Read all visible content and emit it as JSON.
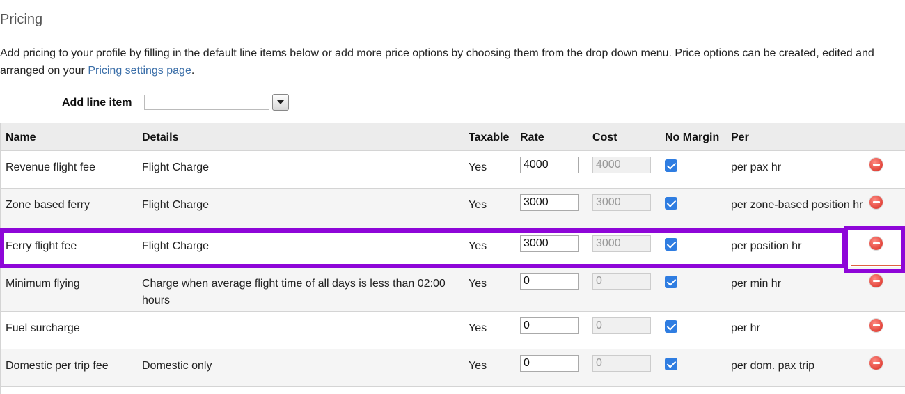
{
  "page": {
    "title": "Pricing",
    "intro_text": "Add pricing to your profile by filling in the default line items below or add more price options by choosing them from the drop down menu. Price options can be created, edited and arranged on your ",
    "intro_link": "Pricing settings page",
    "intro_end": "."
  },
  "add_line_item": {
    "label": "Add line item",
    "selected": ""
  },
  "table": {
    "headers": {
      "name": "Name",
      "details": "Details",
      "taxable": "Taxable",
      "rate": "Rate",
      "cost": "Cost",
      "no_margin": "No Margin",
      "per": "Per"
    },
    "rows": [
      {
        "name": "Revenue flight fee",
        "details": "Flight Charge",
        "taxable": "Yes",
        "rate": "4000",
        "cost": "4000",
        "no_margin": true,
        "per": "per pax hr"
      },
      {
        "name": "Zone based ferry",
        "details": "Flight Charge",
        "taxable": "Yes",
        "rate": "3000",
        "cost": "3000",
        "no_margin": true,
        "per": "per zone-based position hr"
      },
      {
        "name": "Ferry flight fee",
        "details": "Flight Charge",
        "taxable": "Yes",
        "rate": "3000",
        "cost": "3000",
        "no_margin": true,
        "per": "per position hr",
        "highlighted": true
      },
      {
        "name": "Minimum flying",
        "details": "Charge when average flight time of all days is less than 02:00 hours",
        "taxable": "Yes",
        "rate": "0",
        "cost": "0",
        "no_margin": true,
        "per": "per min hr"
      },
      {
        "name": "Fuel surcharge",
        "details": "",
        "taxable": "Yes",
        "rate": "0",
        "cost": "0",
        "no_margin": true,
        "per": "per hr"
      },
      {
        "name": "Domestic per trip fee",
        "details": "Domestic only",
        "taxable": "Yes",
        "rate": "0",
        "cost": "0",
        "no_margin": true,
        "per": "per dom. pax trip"
      }
    ]
  },
  "colors": {
    "highlight": "#8e06d8",
    "link": "#3a6ea8",
    "checkbox": "#2f7de1",
    "remove_button": "#e2453b"
  },
  "icons": {
    "remove": "remove-circle-icon",
    "dropdown": "chevron-down-icon",
    "check": "checkmark-icon"
  }
}
